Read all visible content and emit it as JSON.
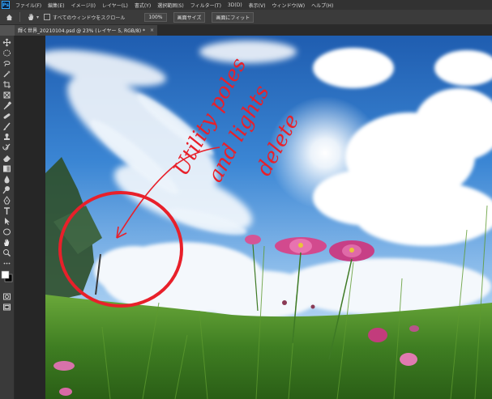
{
  "app": {
    "logo": "Ps"
  },
  "menu": {
    "items": [
      "ファイル(F)",
      "編集(E)",
      "イメージ(I)",
      "レイヤー(L)",
      "書式(Y)",
      "選択範囲(S)",
      "フィルター(T)",
      "3D(D)",
      "表示(V)",
      "ウィンドウ(W)",
      "ヘルプ(H)"
    ]
  },
  "options": {
    "scroll_all_label": "すべてのウィンドウをスクロール",
    "zoom_value": "100%",
    "fit_screen_label": "画面サイズ",
    "fill_screen_label": "画面にフィット"
  },
  "document": {
    "tab_title": "輝く世界_20210104.psd @ 23% (レイヤー 5, RGB/8) *",
    "tab_close": "×"
  },
  "annotation": {
    "color": "#e8202a",
    "lines": [
      "Utility poles",
      "and lights",
      "delete"
    ]
  },
  "icons": {
    "home": "home-icon",
    "hand": "hand-icon",
    "tools": [
      "move-icon",
      "marquee-icon",
      "lasso-icon",
      "magic-wand-icon",
      "crop-icon",
      "frame-icon",
      "eyedropper-icon",
      "healing-icon",
      "brush-icon",
      "stamp-icon",
      "history-brush-icon",
      "eraser-icon",
      "gradient-icon",
      "blur-icon",
      "dodge-icon",
      "pen-icon",
      "type-icon",
      "path-select-icon",
      "shape-icon",
      "hand-icon",
      "zoom-icon",
      "more-icon",
      "color-swatch-icon",
      "quick-mask-icon",
      "screen-mode-icon"
    ]
  }
}
